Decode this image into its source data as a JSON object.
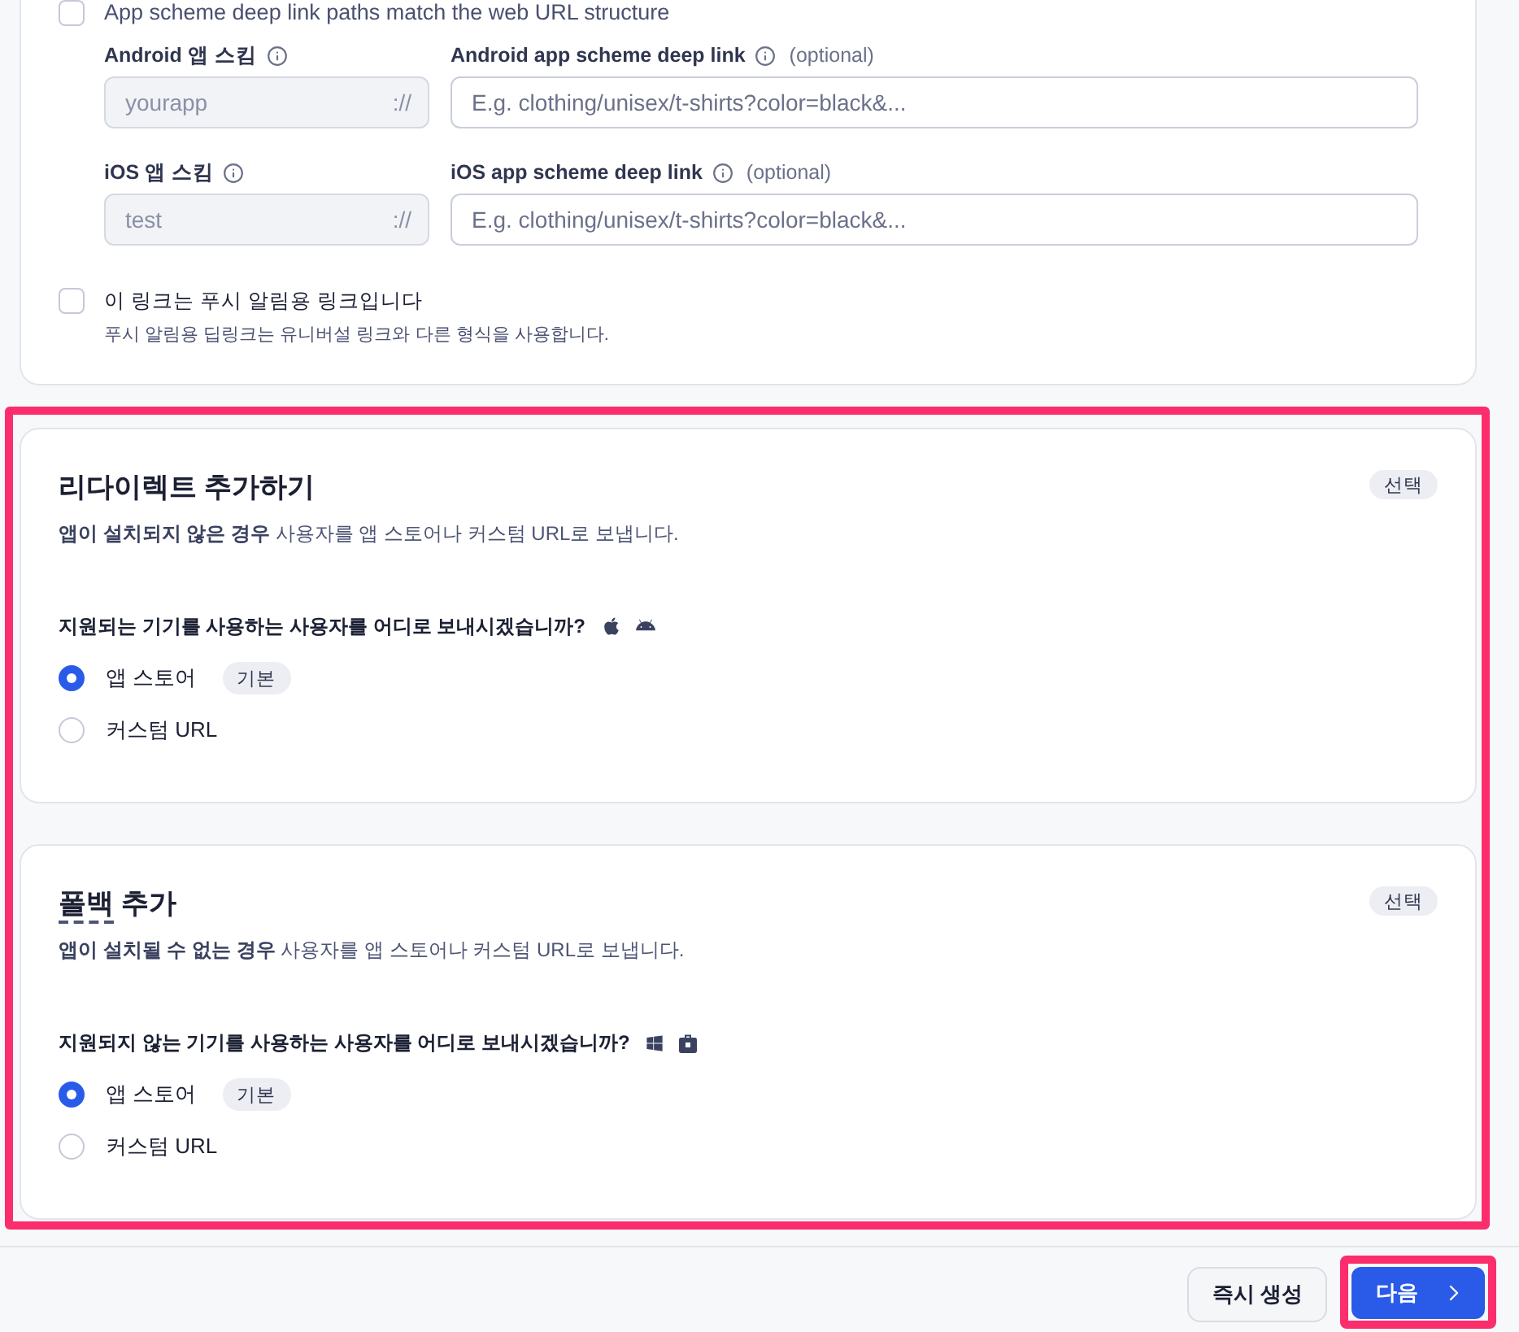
{
  "top_form": {
    "paths_match": {
      "label": "App scheme deep link paths match the web URL structure",
      "checked": false
    },
    "schemes": [
      {
        "scheme_label": "Android 앱 스킴",
        "scheme_value": "yourapp",
        "scheme_suffix": "://",
        "link_label": "Android app scheme deep link",
        "link_note": "(optional)",
        "link_placeholder": "E.g. clothing/unisex/t-shirts?color=black&..."
      },
      {
        "scheme_label": "iOS 앱 스킴",
        "scheme_value": "test",
        "scheme_suffix": "://",
        "link_label": "iOS app scheme deep link",
        "link_note": "(optional)",
        "link_placeholder": "E.g. clothing/unisex/t-shirts?color=black&..."
      }
    ],
    "push_link": {
      "label": "이 링크는 푸시 알림용 링크입니다",
      "help": "푸시 알림용 딥링크는 유니버설 링크와 다른 형식을 사용합니다.",
      "checked": false
    }
  },
  "sections_highlighted": true,
  "sections": [
    {
      "kind": "redirect",
      "title": [
        {
          "text": "리다이렉트 추가하기",
          "underlined": false
        }
      ],
      "badge": "선택",
      "description": "**앱이 설치되지 않은 경우** 사용자를 앱 스토어나 커스텀 URL로 보냅니다.",
      "question": "지원되는 기기를 사용하는 사용자를 어디로 보내시겠습니까?",
      "options": [
        {
          "label": "앱 스토어",
          "badge": "기본",
          "selected": true
        },
        {
          "label": "커스텀 URL",
          "selected": false
        }
      ]
    },
    {
      "kind": "fallback",
      "title": [
        {
          "text": "폴백",
          "underlined": true
        },
        {
          "text": " 추가",
          "underlined": false
        }
      ],
      "badge": "선택",
      "description": "**앱이 설치될 수 없는 경우** 사용자를 앱 스토어나 커스텀 URL로 보냅니다.",
      "question": "지원되지 않는 기기를 사용하는 사용자를 어디로 보내시겠습니까?",
      "options": [
        {
          "label": "앱 스토어",
          "badge": "기본",
          "selected": true
        },
        {
          "label": "커스텀 URL",
          "selected": false
        }
      ]
    }
  ],
  "footer": {
    "buttons": [
      {
        "kind": "secondary",
        "label": "즉시 생성",
        "highlighted": false
      },
      {
        "kind": "primary",
        "label": "다음",
        "highlighted": true
      }
    ]
  }
}
